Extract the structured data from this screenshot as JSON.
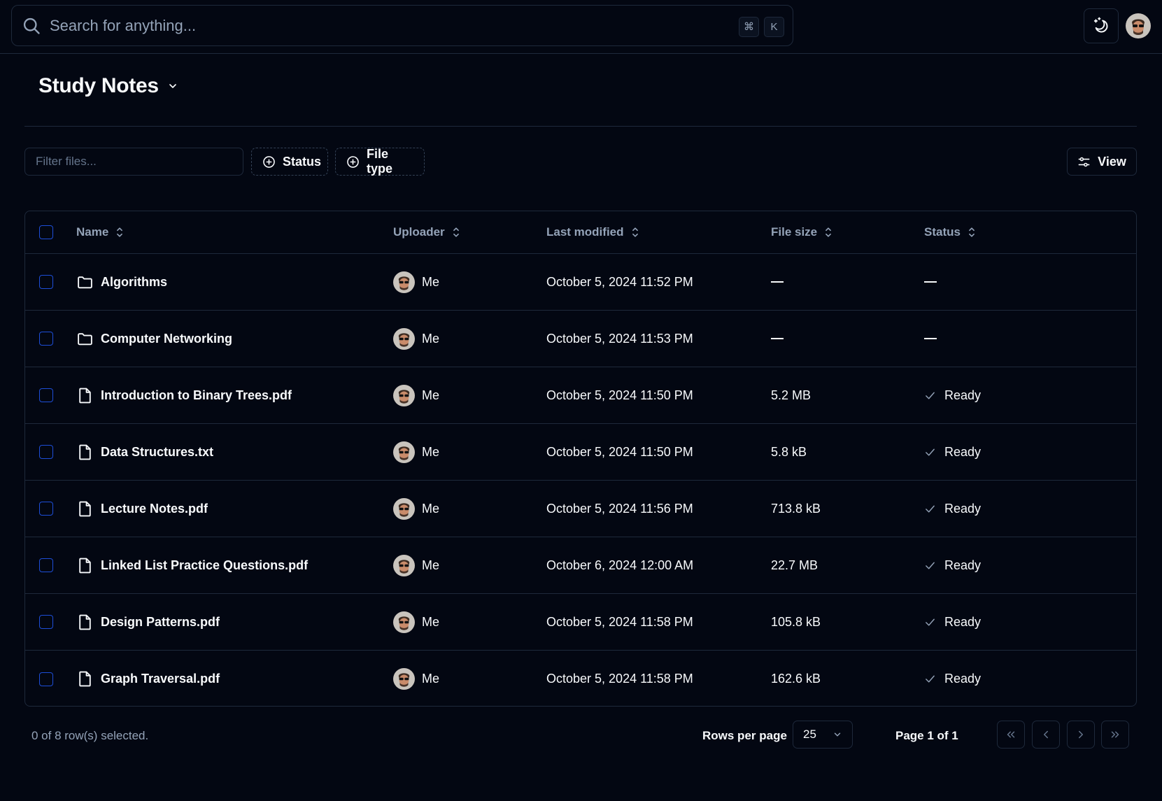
{
  "search": {
    "placeholder": "Search for anything...",
    "shortcut_mod": "⌘",
    "shortcut_key": "K"
  },
  "header": {
    "title": "Study Notes"
  },
  "toolbar": {
    "filter_placeholder": "Filter files...",
    "status_filter_label": "Status",
    "filetype_filter_label": "File type",
    "view_label": "View"
  },
  "table": {
    "columns": {
      "name": "Name",
      "uploader": "Uploader",
      "modified": "Last modified",
      "size": "File size",
      "status": "Status"
    },
    "rows": [
      {
        "type": "folder",
        "name": "Algorithms",
        "uploader": "Me",
        "modified": "October 5, 2024 11:52 PM",
        "size": "",
        "status": ""
      },
      {
        "type": "folder",
        "name": "Computer Networking",
        "uploader": "Me",
        "modified": "October 5, 2024 11:53 PM",
        "size": "",
        "status": ""
      },
      {
        "type": "file",
        "name": "Introduction to Binary Trees.pdf",
        "uploader": "Me",
        "modified": "October 5, 2024 11:50 PM",
        "size": "5.2 MB",
        "status": "Ready"
      },
      {
        "type": "file",
        "name": "Data Structures.txt",
        "uploader": "Me",
        "modified": "October 5, 2024 11:50 PM",
        "size": "5.8 kB",
        "status": "Ready"
      },
      {
        "type": "file",
        "name": "Lecture Notes.pdf",
        "uploader": "Me",
        "modified": "October 5, 2024 11:56 PM",
        "size": "713.8 kB",
        "status": "Ready"
      },
      {
        "type": "file",
        "name": "Linked List Practice Questions.pdf",
        "uploader": "Me",
        "modified": "October 6, 2024 12:00 AM",
        "size": "22.7 MB",
        "status": "Ready"
      },
      {
        "type": "file",
        "name": "Design Patterns.pdf",
        "uploader": "Me",
        "modified": "October 5, 2024 11:58 PM",
        "size": "105.8 kB",
        "status": "Ready"
      },
      {
        "type": "file",
        "name": "Graph Traversal.pdf",
        "uploader": "Me",
        "modified": "October 5, 2024 11:58 PM",
        "size": "162.6 kB",
        "status": "Ready"
      }
    ]
  },
  "footer": {
    "selection": "0 of 8 row(s) selected.",
    "rows_per_page_label": "Rows per page",
    "rows_per_page_value": "25",
    "page_info": "Page 1 of 1"
  },
  "colors": {
    "background": "#030712",
    "border": "#1e293b",
    "muted": "#94a3b8",
    "checkbox": "#1d4ed8"
  }
}
